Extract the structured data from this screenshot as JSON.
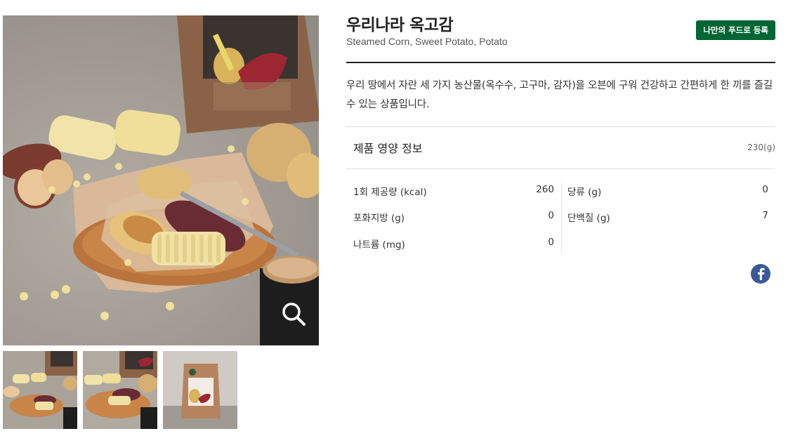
{
  "product": {
    "title": "우리나라 옥고감",
    "subtitle": "Steamed Corn, Sweet Potato, Potato",
    "register_button": "나만의 푸드로 등록",
    "description": "우리 땅에서 자란 세 가지 농산물(옥수수, 고구마, 감자)을 오븐에 구워 건강하고 간편하게 한 끼를 즐길 수 있는 상품입니다."
  },
  "nutrition": {
    "title": "제품 영양 정보",
    "weight": "230(g)",
    "items": [
      {
        "label": "1회 제공량 (kcal)",
        "value": "260"
      },
      {
        "label": "당류 (g)",
        "value": "0"
      },
      {
        "label": "포화지방 (g)",
        "value": "0"
      },
      {
        "label": "단백질 (g)",
        "value": "7"
      },
      {
        "label": "나트륨 (mg)",
        "value": "0"
      }
    ]
  },
  "gallery": {
    "main_image": "corn-sweet-potato-potato-plate-photo",
    "zoom_icon": "search-icon",
    "thumbnails": [
      "thumbnail-plate-1",
      "thumbnail-plate-2",
      "thumbnail-package"
    ]
  },
  "share": {
    "facebook_icon": "facebook-icon"
  },
  "colors": {
    "brand_green": "#006633",
    "facebook_blue": "#3b5998",
    "text_dark": "#222222"
  }
}
